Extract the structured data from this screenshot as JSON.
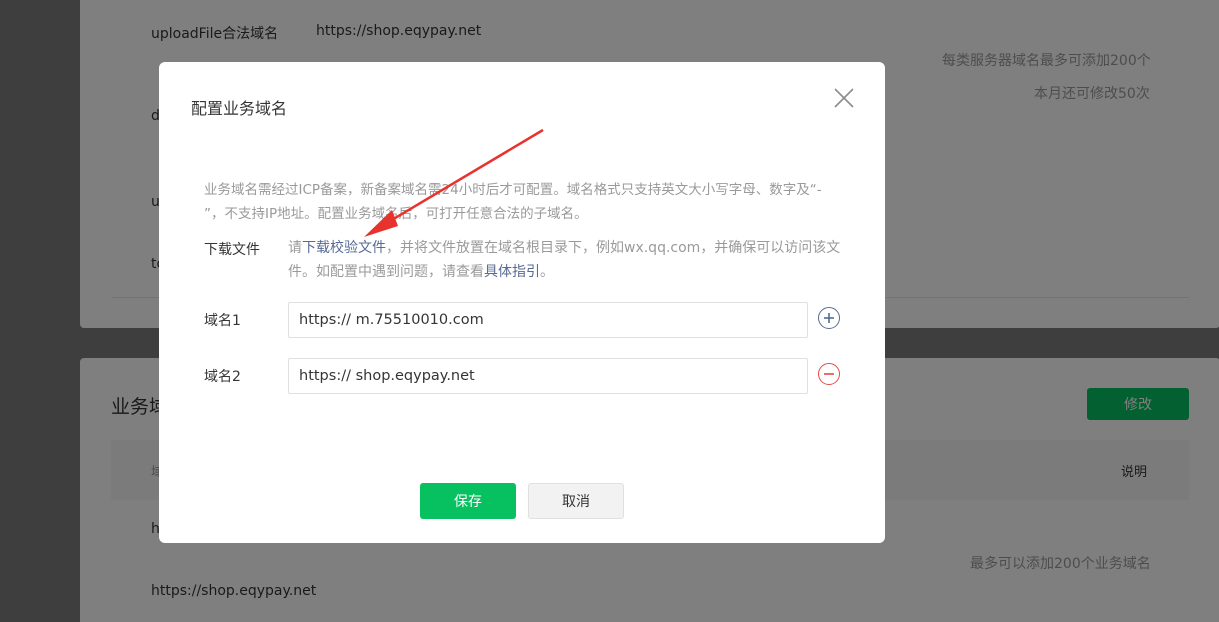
{
  "background": {
    "rows": [
      {
        "label": "uploadFile合法域名",
        "value": "https://shop.eqypay.net"
      },
      {
        "label": "d"
      },
      {
        "label": "u"
      },
      {
        "label": "to"
      }
    ],
    "limit_note": "每类服务器域名最多可添加200个",
    "month_note": "本月还可修改50次",
    "section_title": "业务域名",
    "modify_label": "修改",
    "table_col_left": "域",
    "table_col_right": "说明",
    "row_partial": "h",
    "footer_note": "最多可以添加200个业务域名",
    "footer_domain": "https://shop.eqypay.net"
  },
  "dialog": {
    "title": "配置业务域名",
    "description": "业务域名需经过ICP备案，新备案域名需24小时后才可配置。域名格式只支持英文大小写字母、数字及“- ”，不支持IP地址。配置业务域名后，可打开任意合法的子域名。",
    "download": {
      "label": "下载文件",
      "prefix": "请",
      "link_text": "下载校验文件",
      "middle": "，并将文件放置在域名根目录下，例如wx.qq.com，并确保可以访问该文件。如配置中遇到问题，请查看",
      "guide_link": "具体指引",
      "suffix": "。"
    },
    "domains": [
      {
        "label": "域名1",
        "value": "https:// m.75510010.com",
        "action": "add"
      },
      {
        "label": "域名2",
        "value": "https:// shop.eqypay.net",
        "action": "remove"
      }
    ],
    "save_label": "保存",
    "cancel_label": "取消"
  },
  "colors": {
    "brand_green": "#07c160",
    "link_blue": "#576b95",
    "remove_red": "#e54b44",
    "annotation_arrow": "#e8322e"
  }
}
